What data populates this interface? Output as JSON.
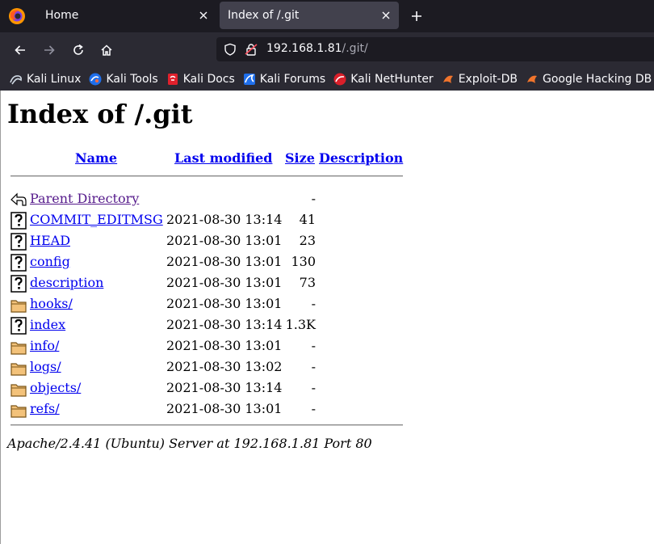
{
  "browser": {
    "tabs": [
      {
        "title": "Home"
      },
      {
        "title": "Index of /.git"
      }
    ],
    "url": {
      "host": "192.168.1.81",
      "path": "/.git/"
    },
    "bookmarks": [
      {
        "label": "Kali Linux",
        "icon": "kali-dragon-icon"
      },
      {
        "label": "Kali Tools",
        "icon": "kali-tools-icon"
      },
      {
        "label": "Kali Docs",
        "icon": "kali-docs-icon"
      },
      {
        "label": "Kali Forums",
        "icon": "kali-forums-icon"
      },
      {
        "label": "Kali NetHunter",
        "icon": "kali-nethunter-icon"
      },
      {
        "label": "Exploit-DB",
        "icon": "exploit-db-icon"
      },
      {
        "label": "Google Hacking DB",
        "icon": "ghdb-icon"
      }
    ]
  },
  "page": {
    "heading": "Index of /.git",
    "columns": {
      "name": "Name",
      "modified": "Last modified",
      "size": "Size",
      "description": "Description"
    },
    "entries": [
      {
        "name": "Parent Directory",
        "modified": "",
        "size": "-",
        "icon": "back-icon"
      },
      {
        "name": "COMMIT_EDITMSG",
        "modified": "2021-08-30 13:14",
        "size": "41",
        "icon": "unknown-file-icon"
      },
      {
        "name": "HEAD",
        "modified": "2021-08-30 13:01",
        "size": "23",
        "icon": "unknown-file-icon"
      },
      {
        "name": "config",
        "modified": "2021-08-30 13:01",
        "size": "130",
        "icon": "unknown-file-icon"
      },
      {
        "name": "description",
        "modified": "2021-08-30 13:01",
        "size": "73",
        "icon": "unknown-file-icon"
      },
      {
        "name": "hooks/",
        "modified": "2021-08-30 13:01",
        "size": "-",
        "icon": "folder-icon"
      },
      {
        "name": "index",
        "modified": "2021-08-30 13:14",
        "size": "1.3K",
        "icon": "unknown-file-icon"
      },
      {
        "name": "info/",
        "modified": "2021-08-30 13:01",
        "size": "-",
        "icon": "folder-icon"
      },
      {
        "name": "logs/",
        "modified": "2021-08-30 13:02",
        "size": "-",
        "icon": "folder-icon"
      },
      {
        "name": "objects/",
        "modified": "2021-08-30 13:14",
        "size": "-",
        "icon": "folder-icon"
      },
      {
        "name": "refs/",
        "modified": "2021-08-30 13:01",
        "size": "-",
        "icon": "folder-icon"
      }
    ],
    "footer": "Apache/2.4.41 (Ubuntu) Server at 192.168.1.81 Port 80"
  }
}
